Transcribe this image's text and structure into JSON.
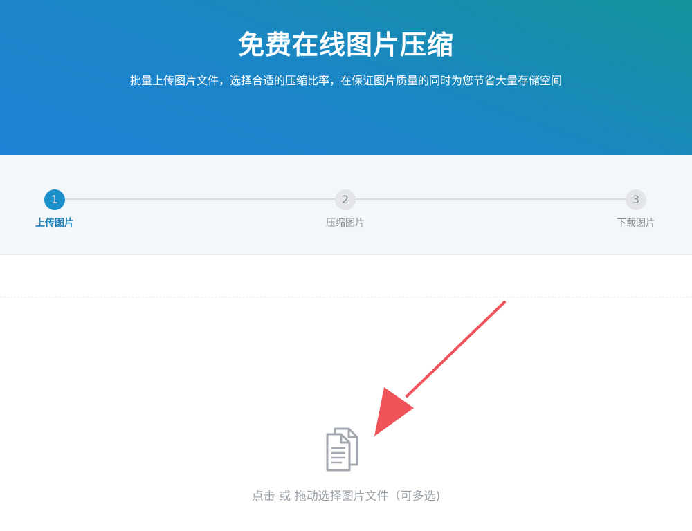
{
  "header": {
    "title": "免费在线图片压缩",
    "subtitle": "批量上传图片文件，选择合适的压缩比率，在保证图片质量的同时为您节省大量存储空间"
  },
  "steps": [
    {
      "number": "1",
      "label": "上传图片",
      "active": true
    },
    {
      "number": "2",
      "label": "压缩图片",
      "active": false
    },
    {
      "number": "3",
      "label": "下载图片",
      "active": false
    }
  ],
  "upload": {
    "icon": "documents-icon",
    "hint": "点击 或 拖动选择图片文件（可多选)"
  },
  "colors": {
    "accent": "#1a8fc9",
    "annotation_arrow": "#f0525a"
  }
}
